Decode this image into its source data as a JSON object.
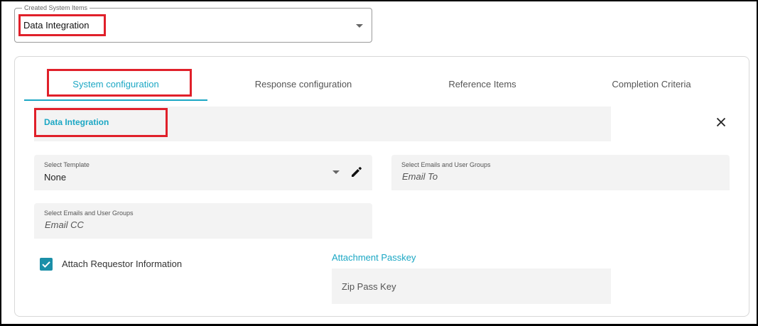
{
  "created_items": {
    "legend": "Created System Items",
    "value": "Data Integration"
  },
  "tabs": [
    {
      "label": "System configuration",
      "active": true
    },
    {
      "label": "Response configuration",
      "active": false
    },
    {
      "label": "Reference Items",
      "active": false
    },
    {
      "label": "Completion Criteria",
      "active": false
    }
  ],
  "section": {
    "title": "Data Integration",
    "close_icon": "close-icon"
  },
  "template": {
    "label": "Select Template",
    "value": "None",
    "edit_icon": "pencil-icon"
  },
  "email_to": {
    "label": "Select Emails and User Groups",
    "placeholder": "Email To"
  },
  "email_cc": {
    "label": "Select Emails and User Groups",
    "placeholder": "Email CC"
  },
  "attach_requestor": {
    "label": "Attach Requestor Information",
    "checked": true
  },
  "passkey": {
    "label": "Attachment Passkey",
    "placeholder": "Zip Pass Key"
  },
  "colors": {
    "accent": "#1ba7c4",
    "highlight": "#e0202a",
    "checkbox": "#1b8fa8",
    "field_bg": "#f3f3f3"
  }
}
